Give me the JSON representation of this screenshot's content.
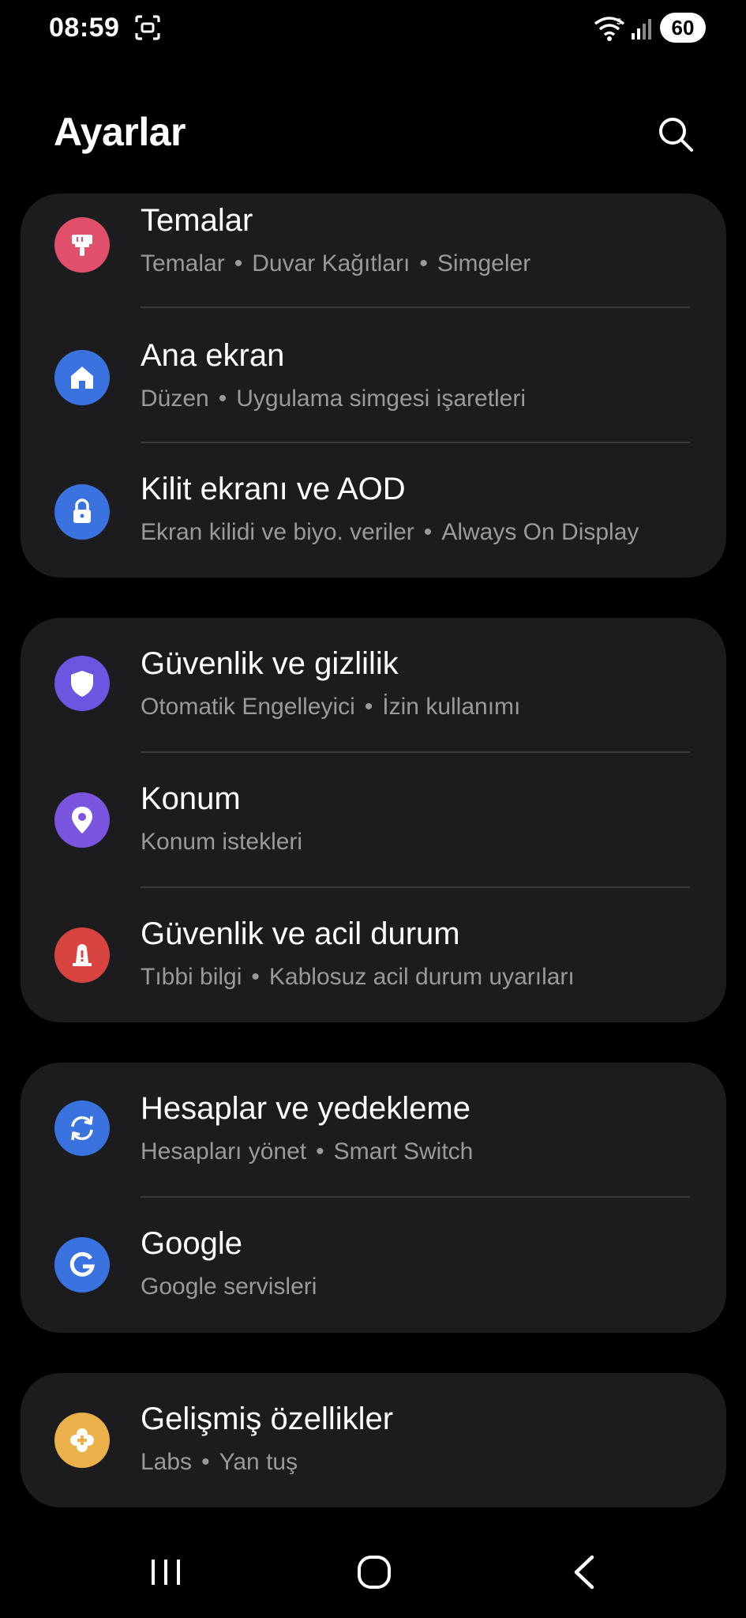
{
  "status_bar": {
    "time": "08:59",
    "battery": "60",
    "icons": [
      "screenshot-icon",
      "wifi-icon",
      "signal-icon",
      "battery-icon"
    ]
  },
  "header": {
    "title": "Ayarlar",
    "search_icon": "search-icon"
  },
  "groups": [
    {
      "items": [
        {
          "title": "Temalar",
          "subtitle": [
            "Temalar",
            "Duvar Kağıtları",
            "Simgeler"
          ],
          "icon": "paintbrush-icon",
          "color": "#e0506b"
        },
        {
          "title": "Ana ekran",
          "subtitle": [
            "Düzen",
            "Uygulama simgesi işaretleri"
          ],
          "icon": "home-icon",
          "color": "#3a72e0"
        },
        {
          "title": "Kilit ekranı ve AOD",
          "subtitle": [
            "Ekran kilidi ve biyo. veriler",
            "Always On Display"
          ],
          "icon": "lock-icon",
          "color": "#3a72e0"
        }
      ]
    },
    {
      "items": [
        {
          "title": "Güvenlik ve gizlilik",
          "subtitle": [
            "Otomatik Engelleyici",
            "İzin kullanımı"
          ],
          "icon": "shield-icon",
          "color": "#6c55e0"
        },
        {
          "title": "Konum",
          "subtitle": [
            "Konum istekleri"
          ],
          "icon": "location-pin-icon",
          "color": "#7a55e0"
        },
        {
          "title": "Güvenlik ve acil durum",
          "subtitle": [
            "Tıbbi bilgi",
            "Kablosuz acil durum uyarıları"
          ],
          "icon": "emergency-icon",
          "color": "#d84440"
        }
      ]
    },
    {
      "items": [
        {
          "title": "Hesaplar ve yedekleme",
          "subtitle": [
            "Hesapları yönet",
            "Smart Switch"
          ],
          "icon": "sync-icon",
          "color": "#3a72e0"
        },
        {
          "title": "Google",
          "subtitle": [
            "Google servisleri"
          ],
          "icon": "google-icon",
          "color": "#3a72e0"
        }
      ]
    },
    {
      "items": [
        {
          "title": "Gelişmiş özellikler",
          "subtitle": [
            "Labs",
            "Yan tuş"
          ],
          "icon": "puzzle-icon",
          "color": "#eab04a"
        }
      ]
    }
  ],
  "navbar": {
    "recents": "recents-icon",
    "home": "home-button-icon",
    "back": "back-icon"
  }
}
